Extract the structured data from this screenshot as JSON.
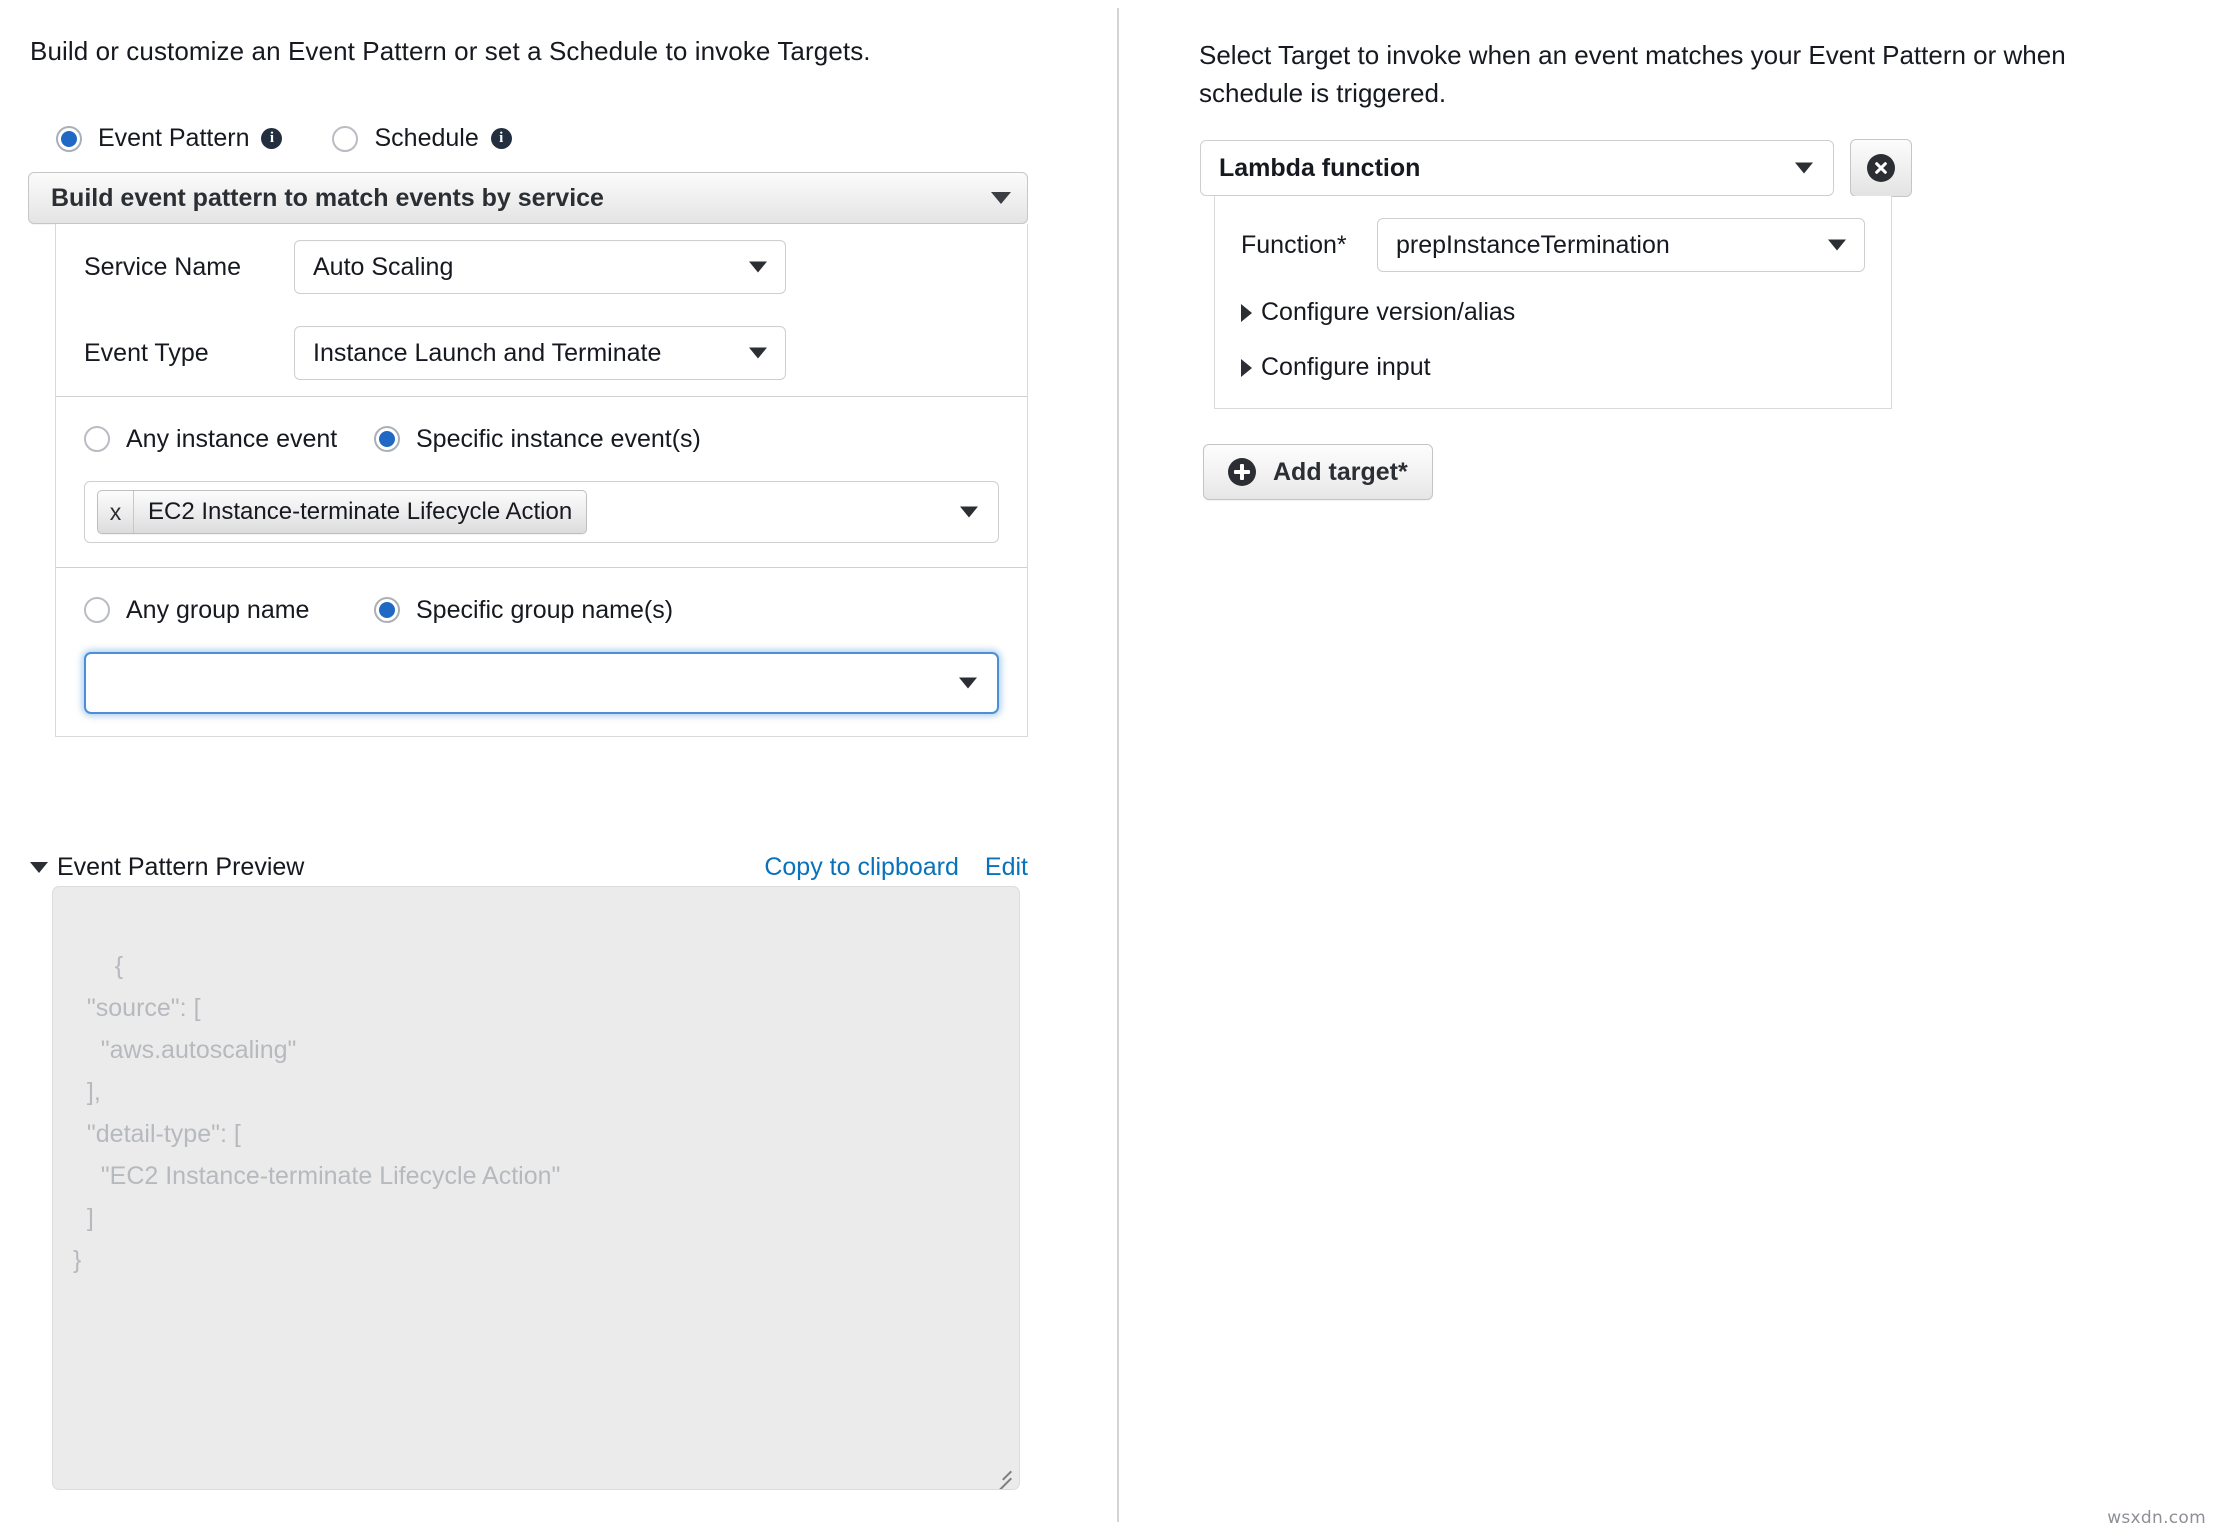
{
  "left": {
    "intro": "Build or customize an Event Pattern or set a Schedule to invoke Targets.",
    "mode_options": [
      {
        "label": "Event Pattern",
        "selected": true,
        "info": "info-icon"
      },
      {
        "label": "Schedule",
        "selected": false,
        "info": "info-icon"
      }
    ],
    "builder_header": "Build event pattern to match events by service",
    "fields": [
      {
        "label": "Service Name",
        "value": "Auto Scaling"
      },
      {
        "label": "Event Type",
        "value": "Instance Launch and Terminate"
      }
    ],
    "instance_event_options": [
      {
        "label": "Any instance event",
        "selected": false
      },
      {
        "label": "Specific instance event(s)",
        "selected": true
      }
    ],
    "instance_event_tokens": [
      {
        "label": "EC2 Instance-terminate Lifecycle Action",
        "remove": "x"
      }
    ],
    "group_name_options": [
      {
        "label": "Any group name",
        "selected": false
      },
      {
        "label": "Specific group name(s)",
        "selected": true
      }
    ],
    "group_name_value": "",
    "preview": {
      "title": "Event Pattern Preview",
      "copy_link": "Copy to clipboard",
      "edit_link": "Edit",
      "json": "{\n  \"source\": [\n    \"aws.autoscaling\"\n  ],\n  \"detail-type\": [\n    \"EC2 Instance-terminate Lifecycle Action\"\n  ]\n}"
    }
  },
  "right": {
    "intro": "Select Target to invoke when an event matches your Event Pattern or when schedule is triggered.",
    "target_type": "Lambda function",
    "remove_target": "remove-target-icon",
    "function_label": "Function*",
    "function_value": "prepInstanceTermination",
    "disclosures": [
      {
        "label": "Configure version/alias"
      },
      {
        "label": "Configure input"
      }
    ],
    "add_target_label": "Add target*"
  },
  "watermark": "wsxdn.com",
  "colors": {
    "accent_blue": "#1f69c4",
    "link_blue": "#0873bb",
    "focus_blue": "#4a90d9",
    "dark": "#2b2f33",
    "preview_bg": "#ebebeb",
    "preview_text": "#b6b9bd"
  }
}
